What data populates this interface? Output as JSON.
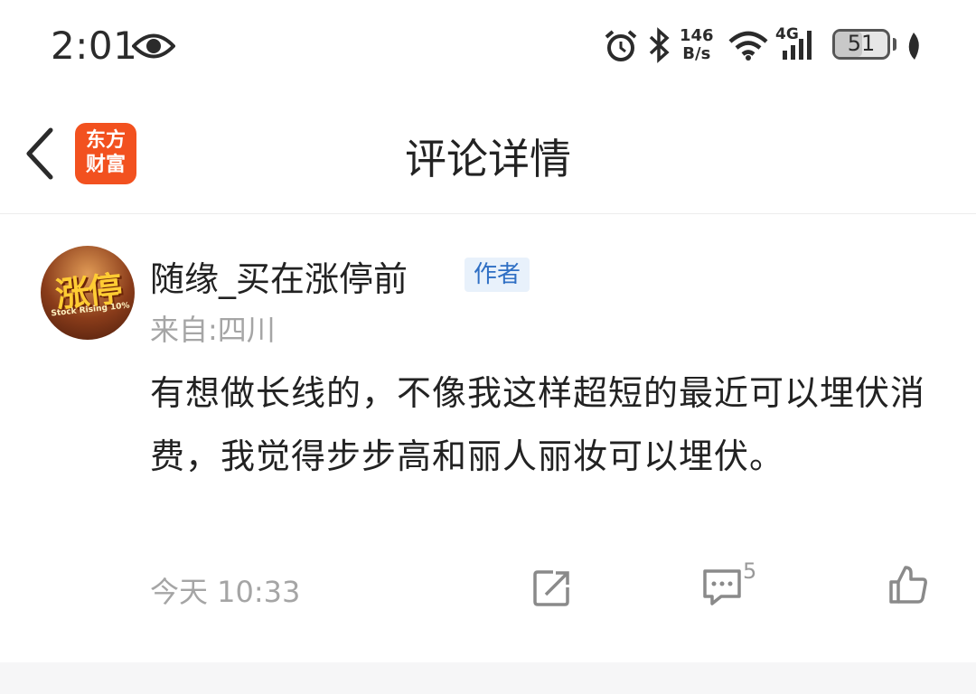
{
  "status_bar": {
    "time": "2:01",
    "net_speed_value": "146",
    "net_speed_unit": "B/s",
    "network_type": "4G",
    "battery_level": "51",
    "battery_percent": 51
  },
  "header": {
    "logo_line1": "东方",
    "logo_line2": "财富",
    "title": "评论详情"
  },
  "comment": {
    "avatar_text": "涨停",
    "avatar_subtext": "Stock Rising 10%",
    "username": "随缘_买在涨停前",
    "author_badge": "作者",
    "location": "来自:四川",
    "content": "有想做长线的，不像我这样超短的最近可以埋伏消费，我觉得步步高和丽人丽妆可以埋伏。",
    "timestamp": "今天 10:33",
    "comment_count": "5"
  },
  "icons": {
    "eye": "eye-icon",
    "alarm": "alarm-icon",
    "bluetooth": "bluetooth-icon",
    "wifi": "wifi-icon",
    "signal": "signal-icon",
    "leaf": "leaf-icon",
    "back": "back-arrow-icon",
    "share": "share-icon",
    "comment": "comment-icon",
    "like": "thumbs-up-icon"
  },
  "colors": {
    "brand": "#f2511f",
    "badge_text": "#2f6fc4",
    "badge_bg": "#e8f1fb",
    "muted_text": "#a5a5a5"
  }
}
